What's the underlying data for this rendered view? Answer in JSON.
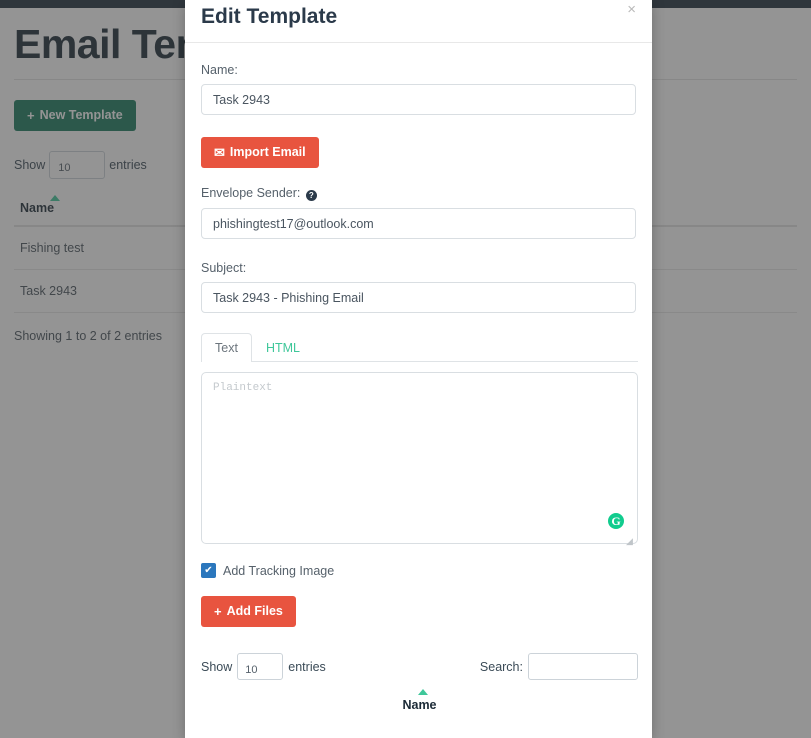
{
  "page": {
    "title": "Email Templates",
    "new_template_button": "New Template",
    "new_template_glyph": "+",
    "length_label_before": "Show",
    "length_value": "10",
    "length_label_after": "entries",
    "table": {
      "columns": [
        "Name"
      ],
      "rows": [
        [
          "Fishing test"
        ],
        [
          "Task 2943"
        ]
      ],
      "info": "Showing 1 to 2 of 2 entries"
    }
  },
  "modal": {
    "title": "Edit Template",
    "close_glyph": "×",
    "name_label": "Name:",
    "name_value": "Task 2943",
    "import_email_button": "Import Email",
    "import_email_glyph": "✉",
    "envelope_sender_label": "Envelope Sender:",
    "envelope_help_glyph": "?",
    "envelope_sender_value": "phishingtest17@outlook.com",
    "subject_label": "Subject:",
    "subject_value": "Task 2943 - Phishing Email",
    "tabs": [
      {
        "label": "Text",
        "active": true
      },
      {
        "label": "HTML",
        "active": false
      }
    ],
    "editor_placeholder": "Plaintext",
    "editor_value": "",
    "grammarly_glyph": "G",
    "tracking_checkbox_label": "Add Tracking Image",
    "tracking_checkbox_checked": true,
    "tracking_check_glyph": "✔",
    "add_files_button": "Add Files",
    "add_files_glyph": "+",
    "attachments_table": {
      "length_label_before": "Show",
      "length_value": "10",
      "length_label_after": "entries",
      "search_label": "Search:",
      "search_value": "",
      "columns": [
        "Name"
      ]
    }
  },
  "colors": {
    "brand_green": "#1a7a5e",
    "accent_red": "#e8543f",
    "tab_link_green": "#3fc79a",
    "checkbox_blue": "#2b77bd",
    "navbar_dark": "#20303c",
    "grammarly_green": "#11cc8e"
  }
}
